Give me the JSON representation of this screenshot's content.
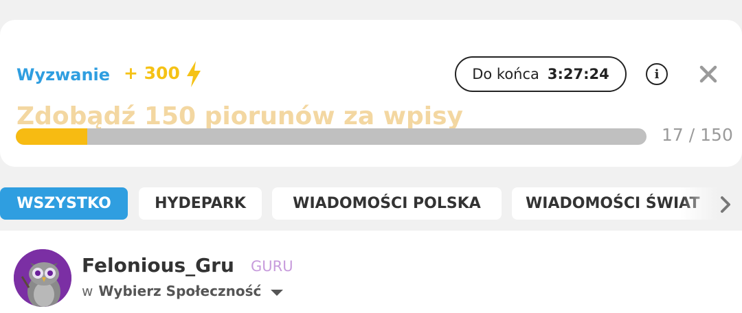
{
  "challenge": {
    "label": "Wyzwanie",
    "bonus": "+ 300",
    "bonus_icon": "lightning-icon",
    "timer_label": "Do końca",
    "timer_value": "3:27:24",
    "title": "Zdobądź 150 piorunów za wpisy",
    "progress_current": 17,
    "progress_total": 150,
    "progress_text": "17 / 150",
    "colors": {
      "label": "#2f9ee0",
      "accent": "#f5c216",
      "title": "#f3d7a1",
      "track": "#c0c0c0",
      "fill": "#f7bb12"
    }
  },
  "tabs": [
    {
      "label": "WSZYSTKO",
      "active": true
    },
    {
      "label": "HYDEPARK",
      "active": false
    },
    {
      "label": "WIADOMOŚCI POLSKA",
      "active": false
    },
    {
      "label": "WIADOMOŚCI ŚWIAT",
      "active": false
    }
  ],
  "post": {
    "username": "Felonious_Gru",
    "rank": "GURU",
    "in_word": "w",
    "community": "Wybierz Społeczność"
  }
}
